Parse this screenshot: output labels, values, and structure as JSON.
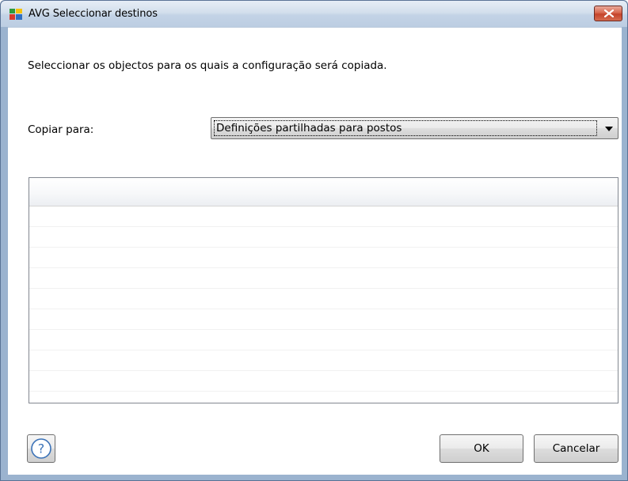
{
  "window": {
    "title": "AVG Seleccionar destinos",
    "app_icon": "avg-logo-icon",
    "close_icon": "close-icon"
  },
  "dialog": {
    "instruction": "Seleccionar os objectos para os quais a configuração será copiada.",
    "copy_to_label": "Copiar para:",
    "copy_to_selected": "Definições partilhadas para postos",
    "dropdown_icon": "chevron-down-icon"
  },
  "targets_table": {
    "columns": [],
    "rows": []
  },
  "buttons": {
    "help_icon": "help-icon",
    "ok_label": "OK",
    "cancel_label": "Cancelar"
  },
  "colors": {
    "close_button": "#c4432a",
    "titlebar": "#d3dfec",
    "window_frame": "#9bb3cf"
  }
}
